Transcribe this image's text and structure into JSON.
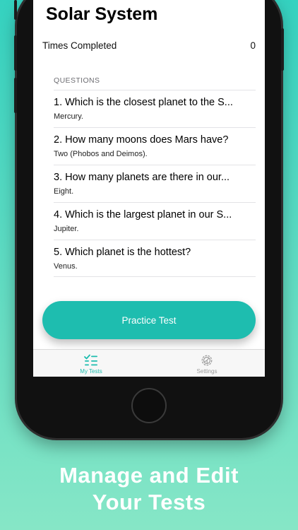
{
  "app": {
    "title": "Solar System"
  },
  "stats": {
    "label": "Times Completed",
    "value": "0"
  },
  "questions": {
    "header": "QUESTIONS",
    "items": [
      {
        "text": "1. Which is the closest planet to the S...",
        "answer": "Mercury."
      },
      {
        "text": "2. How many moons does Mars have?",
        "answer": "Two (Phobos and Deimos)."
      },
      {
        "text": "3. How many planets are there in our...",
        "answer": "Eight."
      },
      {
        "text": "4. Which is the largest planet in our S...",
        "answer": "Jupiter."
      },
      {
        "text": "5. Which planet is the hottest?",
        "answer": "Venus."
      }
    ]
  },
  "practice_button": {
    "label": "Practice Test"
  },
  "tabbar": {
    "tabs": [
      {
        "label": "My Tests",
        "icon": "checklist-icon",
        "active": true
      },
      {
        "label": "Settings",
        "icon": "gear-icon",
        "active": false
      }
    ]
  },
  "marketing": {
    "line1": "Manage and Edit",
    "line2": "Your Tests"
  },
  "colors": {
    "accent": "#1ebdaf",
    "tab_active": "#1ebdaf",
    "tab_inactive": "#9a9a9a",
    "background": "#35d2c0"
  }
}
